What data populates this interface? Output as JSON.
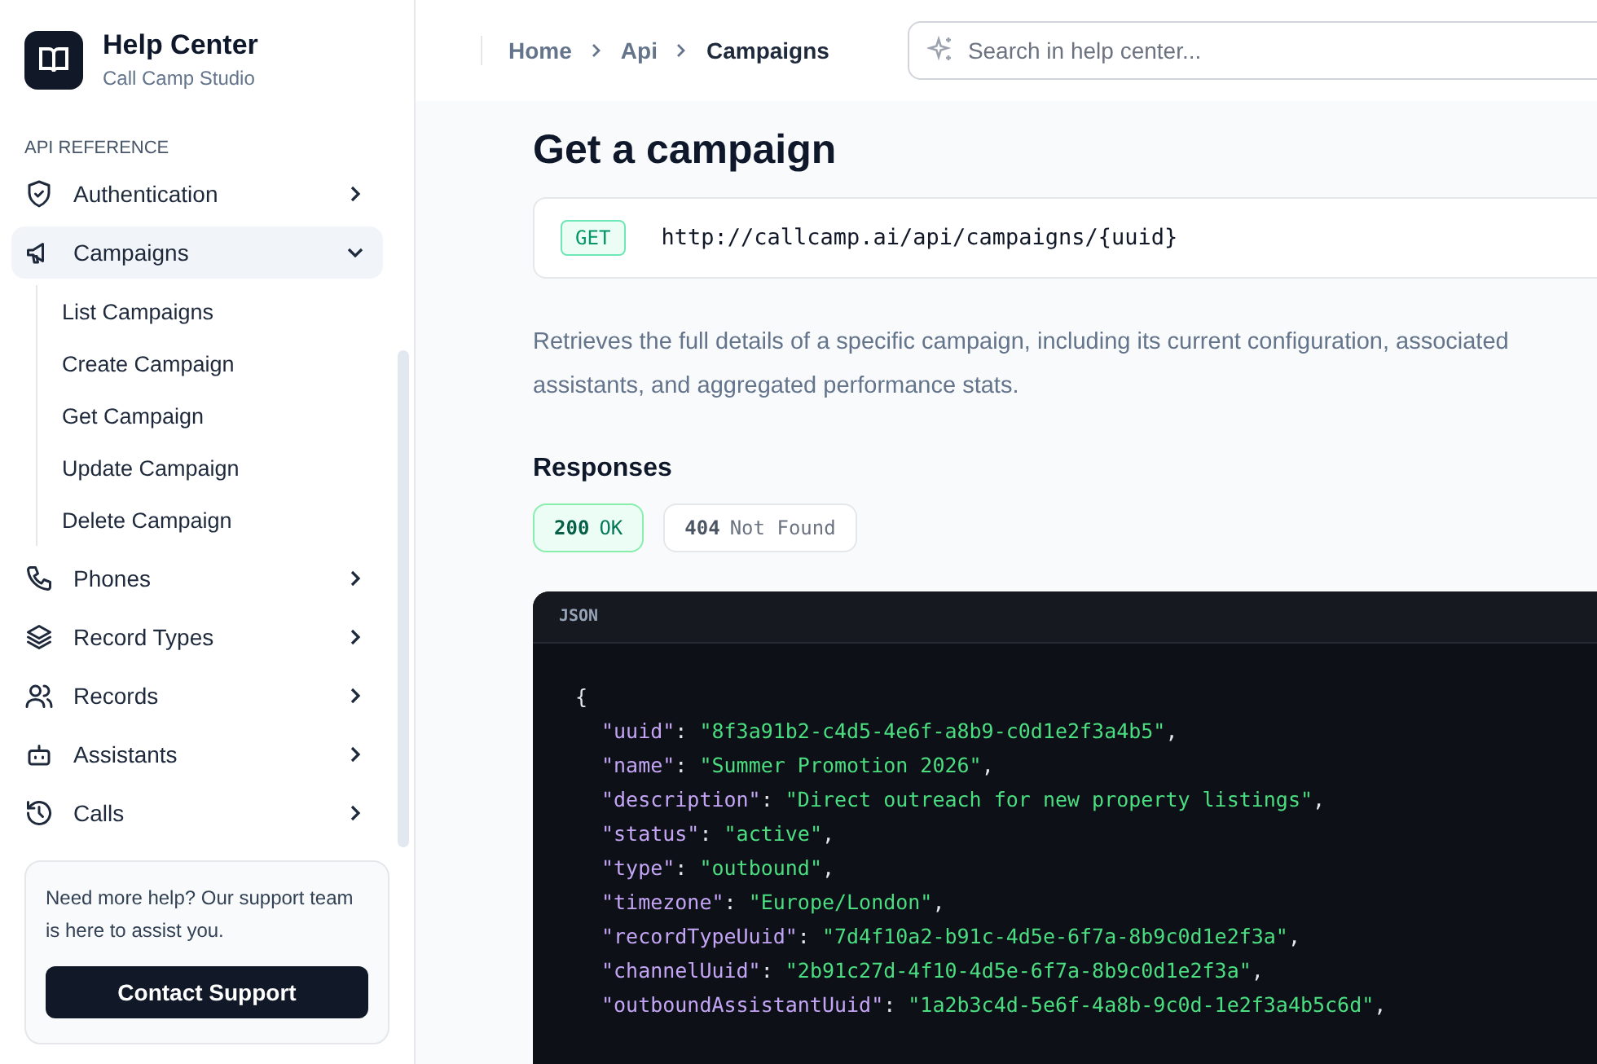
{
  "brand": {
    "title": "Help Center",
    "subtitle": "Call Camp Studio"
  },
  "sidebar": {
    "section": "API REFERENCE",
    "items": [
      {
        "label": "Authentication",
        "selected": false,
        "expanded": false
      },
      {
        "label": "Campaigns",
        "selected": true,
        "expanded": true,
        "children": [
          {
            "label": "List Campaigns"
          },
          {
            "label": "Create Campaign"
          },
          {
            "label": "Get Campaign"
          },
          {
            "label": "Update Campaign"
          },
          {
            "label": "Delete Campaign"
          }
        ]
      },
      {
        "label": "Phones",
        "selected": false,
        "expanded": false
      },
      {
        "label": "Record Types",
        "selected": false,
        "expanded": false
      },
      {
        "label": "Records",
        "selected": false,
        "expanded": false
      },
      {
        "label": "Assistants",
        "selected": false,
        "expanded": false
      },
      {
        "label": "Calls",
        "selected": false,
        "expanded": false
      }
    ],
    "help": {
      "text": "Need more help? Our support team is here to assist you.",
      "button": "Contact Support"
    }
  },
  "breadcrumbs": [
    "Home",
    "Api",
    "Campaigns"
  ],
  "search": {
    "placeholder": "Search in help center..."
  },
  "page": {
    "title": "Get a campaign",
    "method": "GET",
    "url": "http://callcamp.ai/api/campaigns/{uuid}",
    "description": "Retrieves the full details of a specific campaign, including its current configuration, associated assistants, and aggregated performance stats.",
    "responses_heading": "Responses",
    "responses": [
      {
        "code": "200",
        "label": "OK",
        "selected": true
      },
      {
        "code": "404",
        "label": "Not Found",
        "selected": false
      }
    ],
    "code": {
      "language": "JSON",
      "lines": [
        {
          "kind": "brace",
          "text": "{"
        },
        {
          "kind": "pair",
          "key": "\"uuid\"",
          "colon": ":",
          "value": "\"8f3a91b2-c4d5-4e6f-a8b9-c0d1e2f3a4b5\"",
          "comma": ","
        },
        {
          "kind": "pair",
          "key": "\"name\"",
          "colon": ":",
          "value": "\"Summer Promotion 2026\"",
          "comma": ","
        },
        {
          "kind": "pair",
          "key": "\"description\"",
          "colon": ":",
          "value": "\"Direct outreach for new property listings\"",
          "comma": ","
        },
        {
          "kind": "pair",
          "key": "\"status\"",
          "colon": ":",
          "value": "\"active\"",
          "comma": ","
        },
        {
          "kind": "pair",
          "key": "\"type\"",
          "colon": ":",
          "value": "\"outbound\"",
          "comma": ","
        },
        {
          "kind": "pair",
          "key": "\"timezone\"",
          "colon": ":",
          "value": "\"Europe/London\"",
          "comma": ","
        },
        {
          "kind": "pair",
          "key": "\"recordTypeUuid\"",
          "colon": ":",
          "value": "\"7d4f10a2-b91c-4d5e-6f7a-8b9c0d1e2f3a\"",
          "comma": ","
        },
        {
          "kind": "pair",
          "key": "\"channelUuid\"",
          "colon": ":",
          "value": "\"2b91c27d-4f10-4d5e-6f7a-8b9c0d1e2f3a\"",
          "comma": ","
        },
        {
          "kind": "pair",
          "key": "\"outboundAssistantUuid\"",
          "colon": ":",
          "value": "\"1a2b3c4d-5e6f-4a8b-9c0d-1e2f3a4b5c6d\"",
          "comma": ","
        }
      ]
    }
  }
}
